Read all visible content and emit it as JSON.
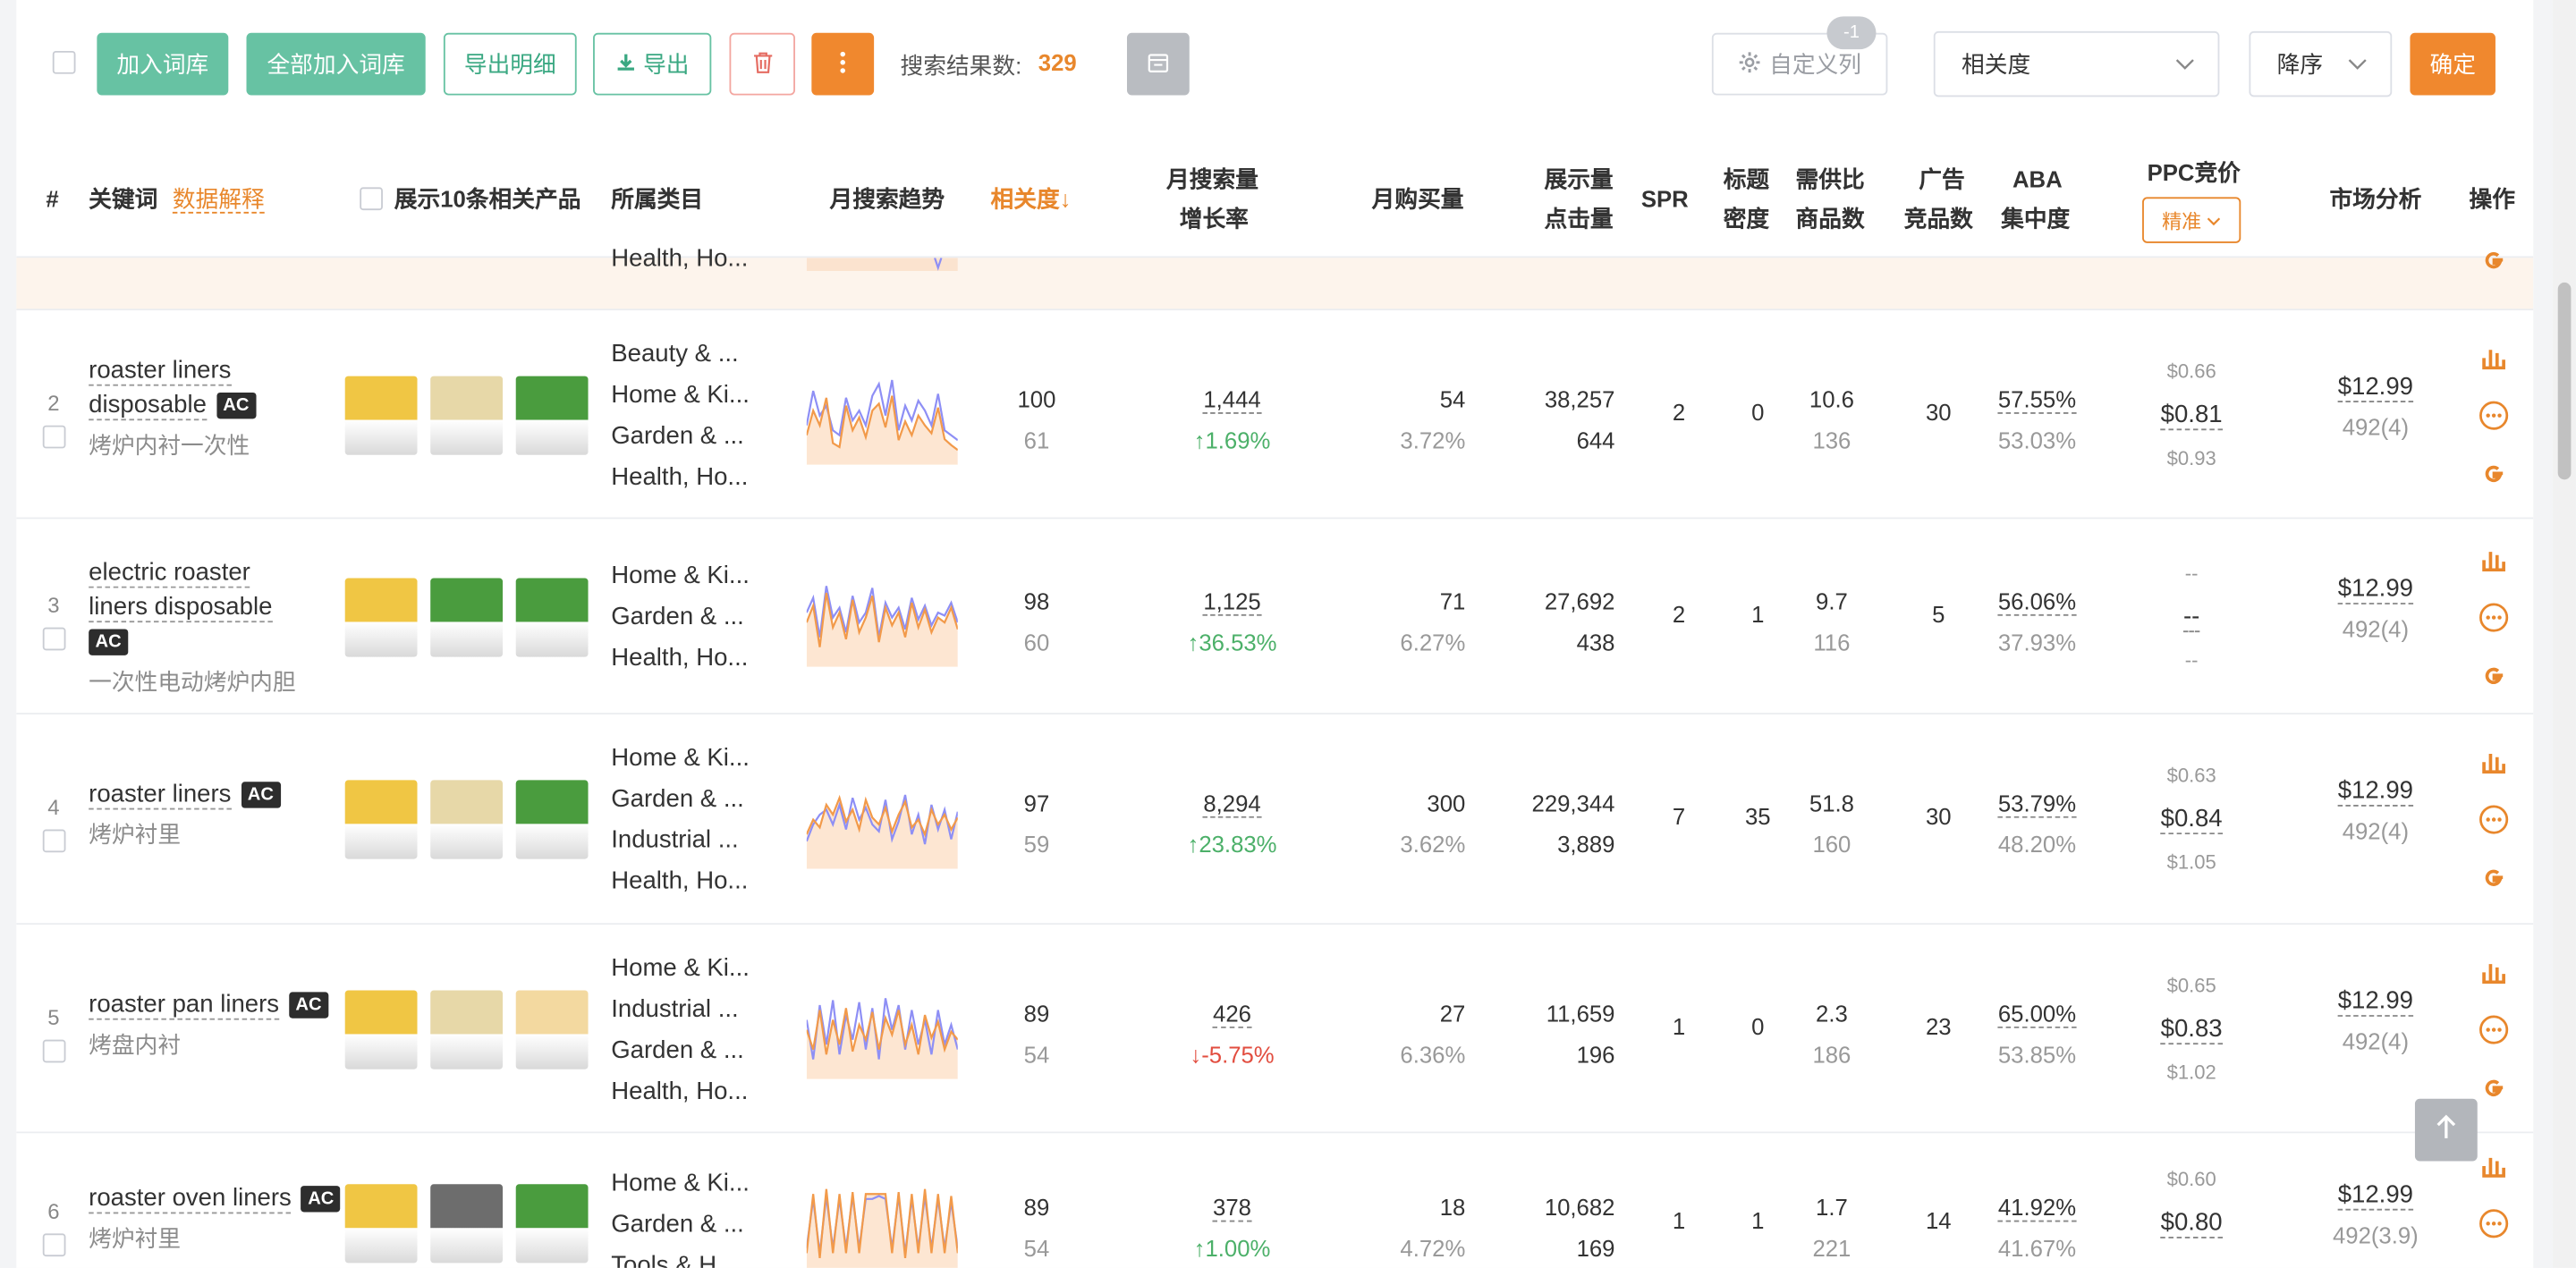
{
  "toolbar": {
    "add_to_lexicon": "加入词库",
    "add_all_to_lexicon": "全部加入词库",
    "export_detail": "导出明细",
    "export": "导出",
    "result_label": "搜索结果数:",
    "result_count": "329",
    "custom_columns": "自定义列",
    "custom_badge": "-1",
    "sort_field": "相关度",
    "sort_order": "降序",
    "confirm": "确定"
  },
  "header": {
    "index": "#",
    "keyword": "关键词",
    "data_explain": "数据解释",
    "show_related": "展示10条相关产品",
    "category": "所属类目",
    "trend": "月搜索趋势",
    "relevance": "相关度↓",
    "growth_1": "月搜索量",
    "growth_2": "增长率",
    "monthly_purchase": "月购买量",
    "impressions": "展示量",
    "clicks": "点击量",
    "spr": "SPR",
    "title_1": "标题",
    "title_2": "密度",
    "supply_1": "需供比",
    "supply_2": "商品数",
    "ads_1": "广告",
    "ads_2": "竞品数",
    "aba_1": "ABA",
    "aba_2": "集中度",
    "ppc": "PPC竞价",
    "precise": "精准",
    "market": "市场分析",
    "ops": "操作"
  },
  "partial_row": {
    "category": "Health, Ho..."
  },
  "rows": [
    {
      "index": "2",
      "keyword_l1": "roaster liners",
      "keyword_l2": "disposable",
      "ac": "AC",
      "keyword_cn": "烤炉内衬一次性",
      "categories": [
        "Beauty & ...",
        "Home & Ki...",
        "Garden & ...",
        "Health, Ho..."
      ],
      "relevance": "100",
      "relevance_sub": "61",
      "search_volume": "1,444",
      "growth": "1.69%",
      "growth_dir": "up",
      "monthly_purchase": "54",
      "purchase_rate": "3.72%",
      "impressions": "38,257",
      "clicks": "644",
      "spr": "2",
      "title_density": "0",
      "supply_ratio": "10.6",
      "products": "136",
      "ad_competitors": "30",
      "aba_1": "57.55%",
      "aba_2": "53.03%",
      "ppc_low": "$0.66",
      "ppc_mid": "$0.81",
      "ppc_high": "$0.93",
      "price": "$12.99",
      "reviews": "492(4)",
      "trend_orange": [
        30,
        55,
        40,
        68,
        22,
        18,
        60,
        35,
        48,
        28,
        55,
        62,
        38,
        70,
        25,
        44,
        30,
        50,
        40,
        32,
        58,
        26,
        20,
        15
      ],
      "trend_purple": [
        40,
        75,
        50,
        60,
        35,
        30,
        68,
        45,
        55,
        40,
        70,
        82,
        50,
        86,
        35,
        60,
        45,
        65,
        55,
        40,
        72,
        35,
        30,
        25
      ]
    },
    {
      "index": "3",
      "keyword_l1": "electric roaster",
      "keyword_l2": "liners disposable",
      "ac": "AC",
      "keyword_cn": "一次性电动烤炉内胆",
      "categories": [
        "Home & Ki...",
        "Garden & ...",
        "Health, Ho..."
      ],
      "relevance": "98",
      "relevance_sub": "60",
      "search_volume": "1,125",
      "growth": "36.53%",
      "growth_dir": "up",
      "monthly_purchase": "71",
      "purchase_rate": "6.27%",
      "impressions": "27,692",
      "clicks": "438",
      "spr": "2",
      "title_density": "1",
      "supply_ratio": "9.7",
      "products": "116",
      "ad_competitors": "5",
      "aba_1": "56.06%",
      "aba_2": "37.93%",
      "ppc_low": "--",
      "ppc_mid": "--",
      "ppc_high": "--",
      "price": "$12.99",
      "reviews": "492(4)",
      "trend_orange": [
        45,
        62,
        20,
        75,
        40,
        55,
        28,
        68,
        35,
        50,
        72,
        25,
        60,
        42,
        55,
        30,
        65,
        40,
        58,
        35,
        50,
        45,
        60,
        38
      ],
      "trend_purple": [
        55,
        70,
        30,
        82,
        50,
        60,
        35,
        72,
        45,
        55,
        80,
        30,
        65,
        50,
        60,
        38,
        70,
        48,
        62,
        42,
        55,
        52,
        65,
        45
      ]
    },
    {
      "index": "4",
      "keyword_l1": "roaster liners",
      "keyword_l2": "",
      "ac": "AC",
      "keyword_cn": "烤炉衬里",
      "categories": [
        "Home & Ki...",
        "Garden & ...",
        "Industrial ...",
        "Health, Ho..."
      ],
      "relevance": "97",
      "relevance_sub": "59",
      "search_volume": "8,294",
      "growth": "23.83%",
      "growth_dir": "up",
      "monthly_purchase": "300",
      "purchase_rate": "3.62%",
      "impressions": "229,344",
      "clicks": "3,889",
      "spr": "7",
      "title_density": "35",
      "supply_ratio": "51.8",
      "products": "160",
      "ad_competitors": "30",
      "aba_1": "53.79%",
      "aba_2": "48.20%",
      "ppc_low": "$0.63",
      "ppc_mid": "$0.84",
      "ppc_high": "$1.05",
      "price": "$12.99",
      "reviews": "492(4)",
      "trend_orange": [
        35,
        50,
        42,
        65,
        55,
        72,
        48,
        60,
        40,
        70,
        52,
        45,
        62,
        38,
        55,
        68,
        42,
        50,
        35,
        60,
        45,
        55,
        40,
        52
      ],
      "trend_purple": [
        28,
        45,
        55,
        60,
        45,
        65,
        40,
        72,
        50,
        62,
        45,
        38,
        70,
        30,
        48,
        75,
        35,
        55,
        25,
        65,
        40,
        60,
        30,
        58
      ]
    },
    {
      "index": "5",
      "keyword_l1": "roaster pan liners",
      "keyword_l2": "",
      "ac": "AC",
      "keyword_cn": "烤盘内衬",
      "categories": [
        "Home & Ki...",
        "Industrial ...",
        "Garden & ...",
        "Health, Ho..."
      ],
      "relevance": "89",
      "relevance_sub": "54",
      "search_volume": "426",
      "growth": "-5.75%",
      "growth_dir": "down",
      "monthly_purchase": "27",
      "purchase_rate": "6.36%",
      "impressions": "11,659",
      "clicks": "196",
      "spr": "1",
      "title_density": "0",
      "supply_ratio": "2.3",
      "products": "186",
      "ad_competitors": "23",
      "aba_1": "65.00%",
      "aba_2": "53.85%",
      "ppc_low": "$0.65",
      "ppc_mid": "$0.83",
      "ppc_high": "$1.02",
      "price": "$12.99",
      "reviews": "492(4)",
      "trend_orange": [
        50,
        30,
        70,
        25,
        60,
        35,
        72,
        28,
        55,
        40,
        68,
        30,
        62,
        45,
        70,
        35,
        55,
        25,
        65,
        42,
        58,
        30,
        48,
        40
      ],
      "trend_purple": [
        60,
        20,
        75,
        35,
        80,
        25,
        65,
        40,
        78,
        30,
        72,
        20,
        82,
        50,
        75,
        30,
        70,
        35,
        60,
        25,
        70,
        35,
        55,
        30
      ]
    },
    {
      "index": "6",
      "keyword_l1": "roaster oven liners",
      "keyword_l2": "",
      "ac": "AC",
      "keyword_cn": "烤炉衬里",
      "categories": [
        "Home & Ki...",
        "Garden & ...",
        "Tools & H..."
      ],
      "relevance": "89",
      "relevance_sub": "54",
      "search_volume": "378",
      "growth": "1.00%",
      "growth_dir": "up",
      "monthly_purchase": "18",
      "purchase_rate": "4.72%",
      "impressions": "10,682",
      "clicks": "169",
      "spr": "1",
      "title_density": "1",
      "supply_ratio": "1.7",
      "products": "221",
      "ad_competitors": "14",
      "aba_1": "41.92%",
      "aba_2": "41.67%",
      "ppc_low": "$0.60",
      "ppc_mid": "$0.80",
      "ppc_high": "",
      "price": "$12.99",
      "reviews": "492(3.9)",
      "trend_orange": [
        20,
        80,
        15,
        85,
        20,
        80,
        20,
        82,
        20,
        80,
        80,
        80,
        80,
        20,
        82,
        15,
        80,
        20,
        85,
        20,
        80,
        20,
        78,
        20
      ],
      "trend_purple": [
        25,
        75,
        20,
        78,
        25,
        75,
        25,
        78,
        25,
        75,
        75,
        78,
        75,
        25,
        78,
        20,
        75,
        25,
        78,
        25,
        75,
        25,
        72,
        25
      ]
    }
  ],
  "colors": {
    "accent": "#e8872c",
    "green": "#67c2a3",
    "up": "#4cb069",
    "down": "#e24d3f",
    "trend_orange": "#f29a4a",
    "trend_purple": "#8e8ff5"
  },
  "icons": {
    "chart": "bar-chart-icon",
    "more": "more-circle-icon",
    "google": "google-icon"
  }
}
